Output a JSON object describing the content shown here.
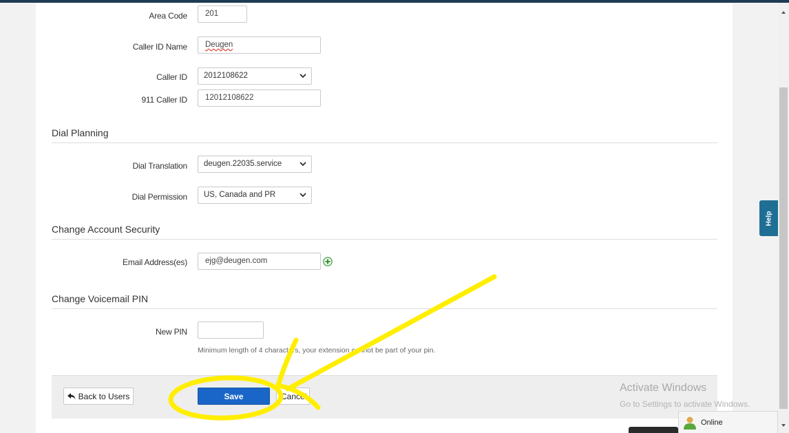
{
  "form": {
    "area_code": {
      "label": "Area Code",
      "value": "201"
    },
    "caller_id_name": {
      "label": "Caller ID Name",
      "value": "Deugen"
    },
    "caller_id": {
      "label": "Caller ID",
      "value": "2012108622"
    },
    "caller_id_911": {
      "label": "911 Caller ID",
      "value": "12012108622"
    }
  },
  "dial_planning": {
    "title": "Dial Planning",
    "translation": {
      "label": "Dial Translation",
      "value": "deugen.22035.service"
    },
    "permission": {
      "label": "Dial Permission",
      "value": "US, Canada and PR"
    }
  },
  "security": {
    "title": "Change Account Security",
    "email": {
      "label": "Email Address(es)",
      "value": "ejg@deugen.com"
    }
  },
  "voicemail": {
    "title": "Change Voicemail PIN",
    "pin": {
      "label": "New PIN",
      "value": ""
    },
    "hint": "Minimum length of 4 characters, your extension cannot be part of your pin."
  },
  "footer": {
    "back_label": "Back to Users",
    "save_label": "Save",
    "cancel_label": "Cancel"
  },
  "watermark": {
    "title": "Activate Windows",
    "subtitle": "Go to Settings to activate Windows."
  },
  "help_tab": "Help",
  "chat_status": "Online",
  "colors": {
    "primary": "#1a66c8",
    "help_tab": "#1f6f95",
    "annotation": "#ffee00",
    "add_icon": "#3a9a3a"
  },
  "icons": [
    "chevron-down-icon",
    "plus-circle-icon",
    "reply-arrow-icon",
    "user-icon",
    "scroll-up-icon",
    "scroll-down-icon"
  ]
}
